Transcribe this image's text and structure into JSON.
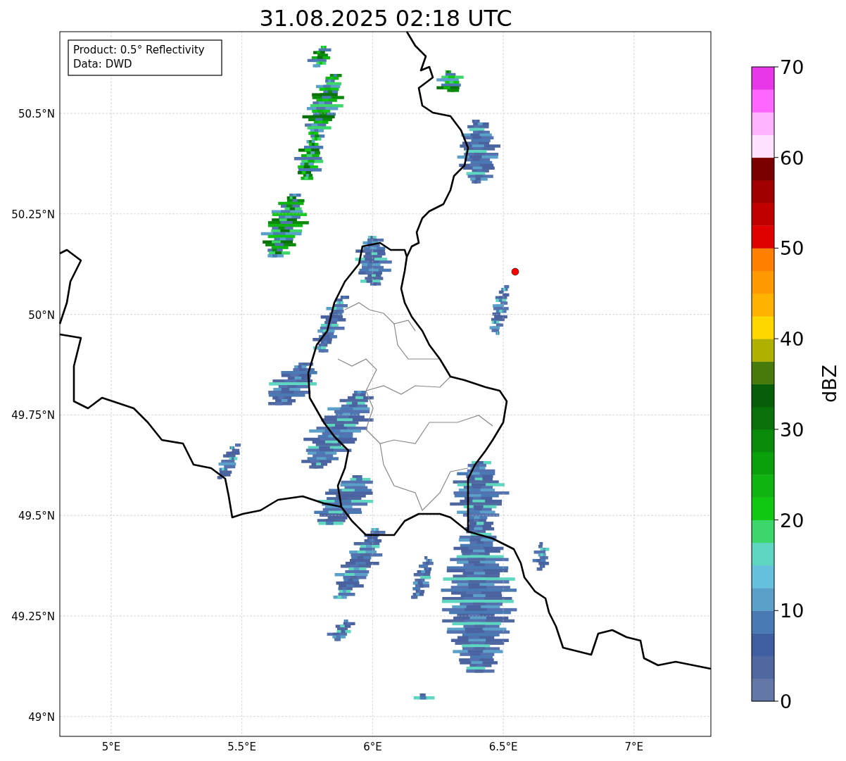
{
  "title": "31.08.2025 02:18 UTC",
  "legend": [
    "Product: 0.5° Reflectivity",
    "Data: DWD"
  ],
  "map": {
    "yticks": [
      "50.5°N",
      "50.25°N",
      "50°N",
      "49.75°N",
      "49.5°N",
      "49.25°N",
      "49°N"
    ],
    "xticks": [
      "5°E",
      "5.5°E",
      "6°E",
      "6.5°E",
      "7°E"
    ]
  },
  "colorbar": {
    "label": "dBZ",
    "ticks": [
      "70",
      "60",
      "50",
      "40",
      "30",
      "20",
      "10",
      "0"
    ],
    "colors": [
      {
        "color": "#6478a8"
      },
      {
        "color": "#5068a0"
      },
      {
        "color": "#405fa0"
      },
      {
        "color": "#4a7ab4"
      },
      {
        "color": "#5aa0c8"
      },
      {
        "color": "#64c0dc"
      },
      {
        "color": "#5fd6c0"
      },
      {
        "color": "#3dd66a"
      },
      {
        "color": "#10c810"
      },
      {
        "color": "#10b410"
      },
      {
        "color": "#0aa00a"
      },
      {
        "color": "#0a8a0a"
      },
      {
        "color": "#0a700a"
      },
      {
        "color": "#085d08"
      },
      {
        "color": "#467a0a"
      },
      {
        "color": "#b0b000"
      },
      {
        "color": "#ffd700"
      },
      {
        "color": "#ffb300"
      },
      {
        "color": "#ff9900"
      },
      {
        "color": "#ff7f00"
      },
      {
        "color": "#e00000"
      },
      {
        "color": "#c00000"
      },
      {
        "color": "#a00000"
      },
      {
        "color": "#7a0000"
      },
      {
        "color": "#ffe0ff"
      },
      {
        "color": "#ffb3ff"
      },
      {
        "color": "#ff66ff"
      },
      {
        "color": "#e837e8"
      }
    ]
  }
}
